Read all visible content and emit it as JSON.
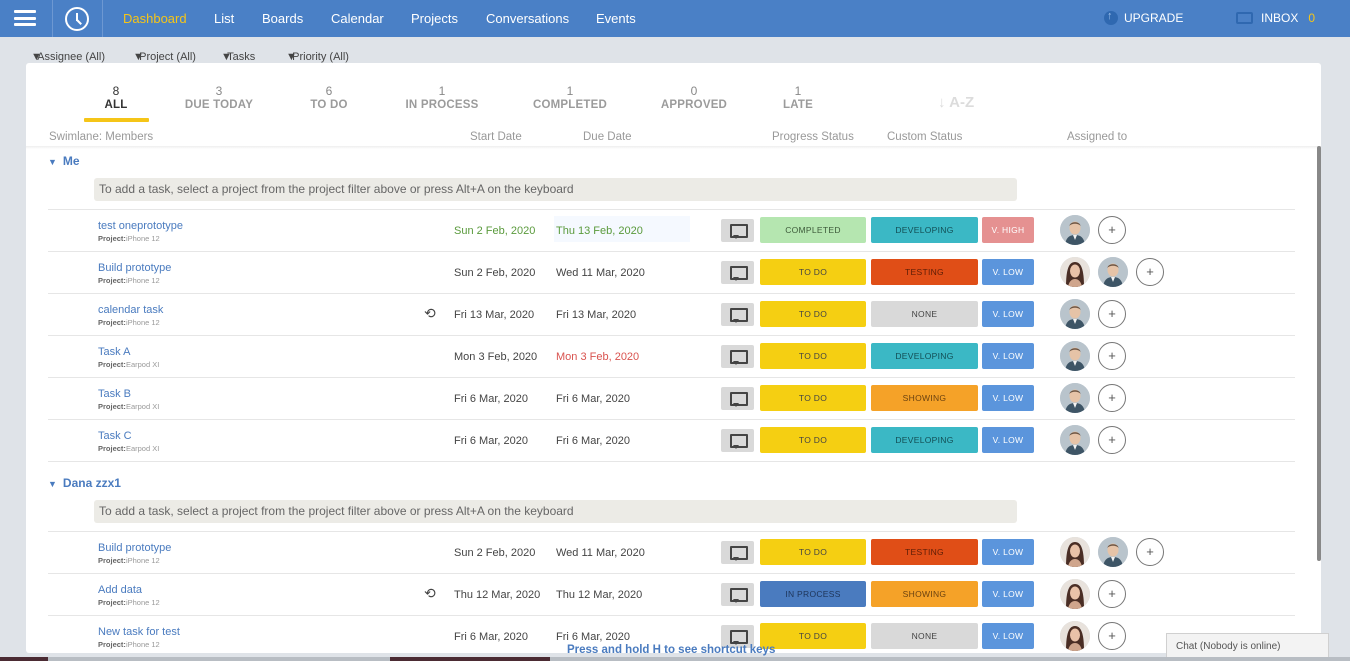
{
  "nav": {
    "items": [
      "Dashboard",
      "List",
      "Boards",
      "Calendar",
      "Projects",
      "Conversations",
      "Events"
    ],
    "active": "Dashboard",
    "upgrade_label": "UPGRADE",
    "inbox_label": "INBOX",
    "inbox_count": "0"
  },
  "filters": {
    "assignee": "Assignee (All)",
    "project": "Project (All)",
    "tasks": "Tasks",
    "priority": "Priority (All)"
  },
  "tabs": [
    {
      "count": "8",
      "label": "ALL",
      "active": true
    },
    {
      "count": "3",
      "label": "DUE TODAY"
    },
    {
      "count": "6",
      "label": "TO DO"
    },
    {
      "count": "1",
      "label": "IN PROCESS"
    },
    {
      "count": "1",
      "label": "COMPLETED"
    },
    {
      "count": "0",
      "label": "APPROVED"
    },
    {
      "count": "1",
      "label": "LATE"
    }
  ],
  "sort_label": "↓ A-Z",
  "columns": {
    "swimlane": "Swimlane: Members",
    "start": "Start Date",
    "due": "Due Date",
    "progress": "Progress Status",
    "custom": "Custom Status",
    "assigned": "Assigned to"
  },
  "hint_text": "To add a task, select a project from the project filter above or press Alt+A on the keyboard",
  "project_prefix": "Project:",
  "groups": [
    {
      "name": "Me",
      "tasks": [
        {
          "name": "test oneprototype",
          "project": "iPhone 12",
          "start": "Sun 2 Feb, 2020",
          "due": "Thu 13 Feb, 2020",
          "progress": "COMPLETED",
          "custom": "DEVELOPING",
          "priority": "V. HIGH",
          "avatars": [
            "man"
          ]
        },
        {
          "name": "Build prototype",
          "project": "iPhone 12",
          "start": "Sun 2 Feb, 2020",
          "due": "Wed 11 Mar, 2020",
          "progress": "TO DO",
          "custom": "TESTING",
          "priority": "V. LOW",
          "avatars": [
            "woman",
            "man"
          ]
        },
        {
          "name": "calendar task",
          "project": "iPhone 12",
          "start": "Fri 13 Mar, 2020",
          "due": "Fri 13 Mar, 2020",
          "progress": "TO DO",
          "custom": "NONE",
          "priority": "V. LOW",
          "avatars": [
            "man"
          ]
        },
        {
          "name": "Task A",
          "project": "Earpod XI",
          "start": "Mon 3 Feb, 2020",
          "due": "Mon 3 Feb, 2020",
          "progress": "TO DO",
          "custom": "DEVELOPING",
          "priority": "V. LOW",
          "avatars": [
            "man"
          ]
        },
        {
          "name": "Task B",
          "project": "Earpod XI",
          "start": "Fri 6 Mar, 2020",
          "due": "Fri 6 Mar, 2020",
          "progress": "TO DO",
          "custom": "SHOWING",
          "priority": "V. LOW",
          "avatars": [
            "man"
          ]
        },
        {
          "name": "Task C",
          "project": "Earpod XI",
          "start": "Fri 6 Mar, 2020",
          "due": "Fri 6 Mar, 2020",
          "progress": "TO DO",
          "custom": "DEVELOPING",
          "priority": "V. LOW",
          "avatars": [
            "man"
          ]
        }
      ]
    },
    {
      "name": "Dana zzx1",
      "tasks": [
        {
          "name": "Build prototype",
          "project": "iPhone 12",
          "start": "Sun 2 Feb, 2020",
          "due": "Wed 11 Mar, 2020",
          "progress": "TO DO",
          "custom": "TESTING",
          "priority": "V. LOW",
          "avatars": [
            "woman",
            "man"
          ]
        },
        {
          "name": "Add data",
          "project": "iPhone 12",
          "start": "Thu 12 Mar, 2020",
          "due": "Thu 12 Mar, 2020",
          "progress": "IN PROCESS",
          "custom": "SHOWING",
          "priority": "V. LOW",
          "avatars": [
            "woman"
          ]
        },
        {
          "name": "New task for test",
          "project": "iPhone 12",
          "start": "Fri 6 Mar, 2020",
          "due": "Fri 6 Mar, 2020",
          "progress": "TO DO",
          "custom": "NONE",
          "priority": "V. LOW",
          "avatars": [
            "woman"
          ]
        }
      ]
    }
  ],
  "shortcut_text": "Press and hold H to see shortcut keys",
  "chat_text": "Chat (Nobody is online)",
  "colors": {
    "nav_bg": "#4a80c6",
    "accent_yellow": "#f5c518",
    "completed": "#b5e6b0",
    "todo": "#f5cf12",
    "in_process": "#4a7bbf",
    "developing": "#3bb8c5",
    "testing": "#e04e17",
    "none": "#d9d9d9",
    "showing": "#f5a228",
    "v_high": "#e59191",
    "v_low": "#5b95dc"
  }
}
